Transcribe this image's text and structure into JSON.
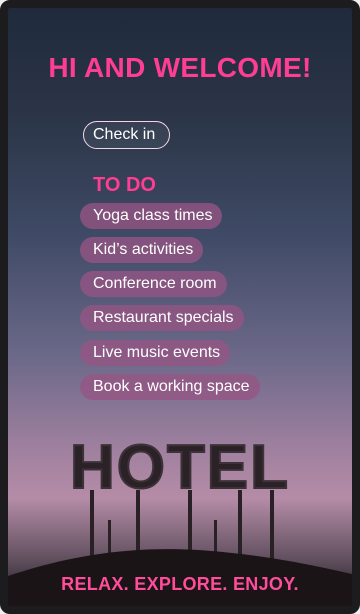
{
  "header": {
    "title": "HI AND WELCOME!"
  },
  "checkin": {
    "label": "Check in"
  },
  "todo": {
    "heading": "TO DO",
    "items": [
      "Yoga class times",
      "Kid’s activities",
      "Conference room",
      "Restaurant specials",
      "Live music events",
      "Book a working space"
    ]
  },
  "sign": {
    "text": "HOTEL"
  },
  "footer": {
    "tagline": "RELAX. EXPLORE. ENJOY."
  },
  "colors": {
    "accent": "#ff3d93",
    "pill": "#965484",
    "bezel": "#1c1c1e"
  }
}
